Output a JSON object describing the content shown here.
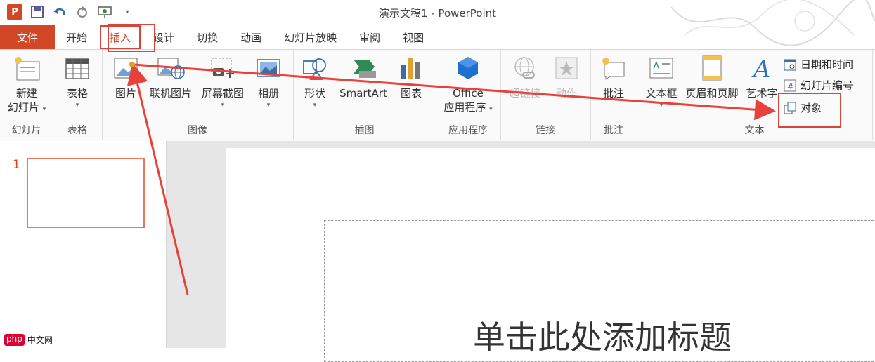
{
  "window": {
    "title": "演示文稿1 - PowerPoint",
    "app_logo": "P"
  },
  "qat": {
    "icons": [
      "save-icon",
      "undo-icon",
      "redo-icon",
      "present-icon",
      "customize-icon"
    ]
  },
  "tabs": [
    "文件",
    "开始",
    "插入",
    "设计",
    "切换",
    "动画",
    "幻灯片放映",
    "审阅",
    "视图"
  ],
  "ribbon": {
    "slides": {
      "new_slide_1": "新建",
      "new_slide_2": "幻灯片",
      "group": "幻灯片"
    },
    "tables": {
      "table": "表格",
      "group": "表格"
    },
    "images": {
      "picture": "图片",
      "online_picture": "联机图片",
      "screenshot": "屏幕截图",
      "album": "相册",
      "group": "图像"
    },
    "illustrations": {
      "shapes": "形状",
      "smartart": "SmartArt",
      "chart": "图表",
      "group": "插图"
    },
    "apps": {
      "office_1": "Office",
      "office_2": "应用程序",
      "group": "应用程序"
    },
    "links": {
      "hyperlink": "超链接",
      "action": "动作",
      "group": "链接"
    },
    "comments": {
      "comment": "批注",
      "group": "批注"
    },
    "text": {
      "textbox": "文本框",
      "header_footer": "页眉和页脚",
      "wordart": "艺术字",
      "date_time": "日期和时间",
      "slide_number": "幻灯片编号",
      "object": "对象",
      "group": "文本"
    }
  },
  "thumbnails": {
    "slide_number": "1"
  },
  "slide": {
    "title_placeholder": "单击此处添加标题"
  },
  "watermark": {
    "php": "php",
    "site": "中文网"
  },
  "colors": {
    "accent": "#d24726",
    "highlight": "#d9453a"
  }
}
